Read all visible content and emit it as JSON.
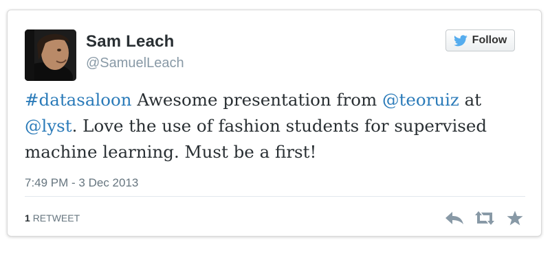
{
  "tweet": {
    "author": {
      "name": "Sam Leach",
      "handle": "@SamuelLeach"
    },
    "follow_label": "Follow",
    "text": {
      "hashtag": "#datasaloon",
      "part1": " Awesome presentation from ",
      "mention1": "@teoruiz",
      "part2": " at ",
      "mention2": "@lyst",
      "part3": ". Love the use of fashion students for supervised machine learning. Must be a first!"
    },
    "timestamp": "7:49 PM - 3 Dec 2013",
    "retweet_count": "1",
    "retweet_label": "RETWEET"
  },
  "icons": {
    "follow": "twitter-bird-icon",
    "reply": "reply-icon",
    "retweet": "retweet-icon",
    "favorite": "star-icon"
  },
  "colors": {
    "link": "#2b7bb9",
    "text": "#292f33",
    "muted": "#66757f",
    "twitter_blue": "#55acee"
  }
}
